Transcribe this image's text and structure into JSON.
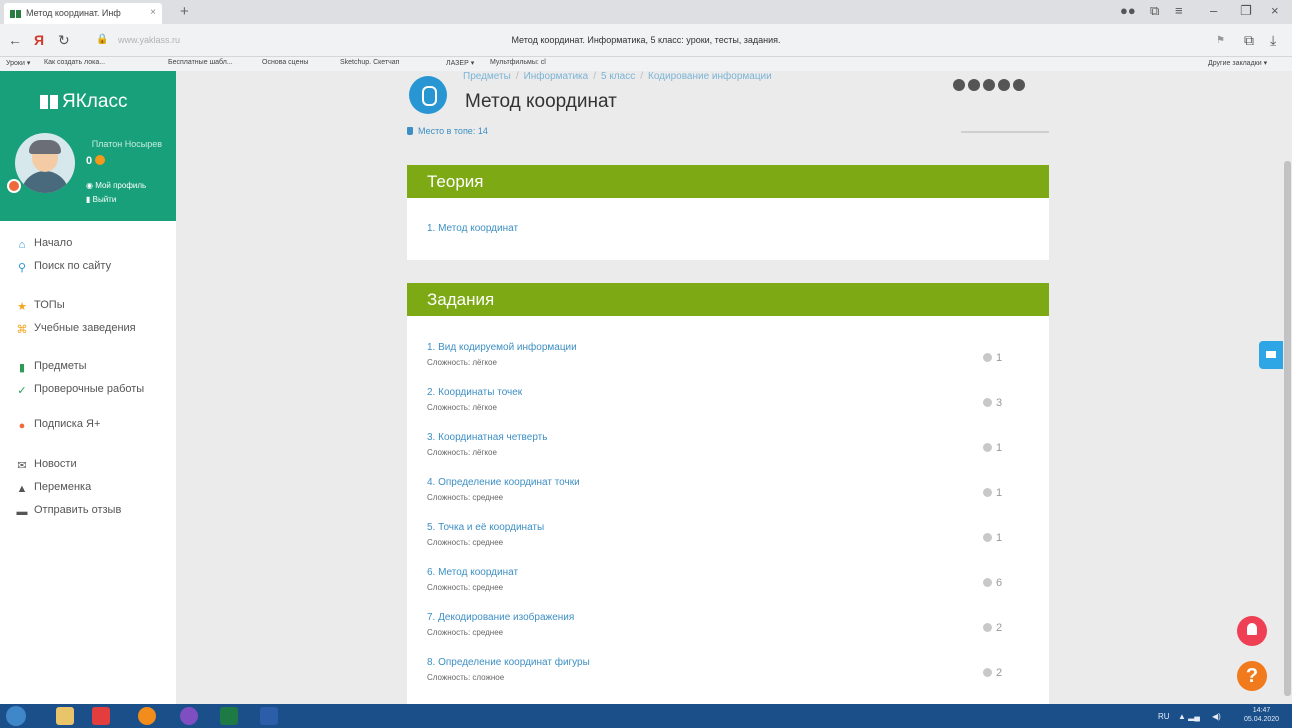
{
  "browser": {
    "tab_title": "Метод координат. Инф",
    "tab_close": "×",
    "new_tab": "+",
    "url": "www.yaklass.ru",
    "page_title": "Метод координат. Информатика, 5 класс: уроки, тесты, задания.",
    "bookmarks": [
      "Уроки ▾",
      "Как создать лока...",
      "Бесплатные шабл...",
      "Основа сцены",
      "Sketchup. Скетчап",
      "ЛАЗЕР ▾",
      "Мультфильмы: сl"
    ],
    "other_bookmarks": "Другие закладки ▾"
  },
  "sidebar": {
    "logo": "ЯКласс",
    "user_name": "Платон Носырев",
    "points": "0",
    "profile_link": "Мой профиль",
    "logout_link": "Выйти",
    "menu": [
      {
        "label": "Начало",
        "icon": "home-icon",
        "color": "#2896d2"
      },
      {
        "label": "Поиск по сайту",
        "icon": "search-icon",
        "color": "#2896d2"
      },
      {
        "label": "ТОПы",
        "icon": "star-icon",
        "color": "#f2a520"
      },
      {
        "label": "Учебные заведения",
        "icon": "school-icon",
        "color": "#f2a520"
      },
      {
        "label": "Предметы",
        "icon": "books-icon",
        "color": "#2e9a57"
      },
      {
        "label": "Проверочные работы",
        "icon": "check-icon",
        "color": "#2e9a57"
      },
      {
        "label": "Подписка Я+",
        "icon": "plus-icon",
        "color": "#ef6a3a"
      },
      {
        "label": "Новости",
        "icon": "news-icon",
        "color": "#555555"
      },
      {
        "label": "Переменка",
        "icon": "bell-icon",
        "color": "#555555"
      },
      {
        "label": "Отправить отзыв",
        "icon": "feedback-icon",
        "color": "#555555"
      }
    ]
  },
  "main": {
    "breadcrumbs": [
      "Предметы",
      "Информатика",
      "5 класс",
      "Кодирование информации"
    ],
    "crumb_sep": "/",
    "title": "Метод координат",
    "rank": "Место в топе: 14",
    "theory": {
      "heading": "Теория",
      "items": [
        "1. Метод координат"
      ]
    },
    "tasks": {
      "heading": "Задания",
      "items": [
        {
          "title": "1. Вид кодируемой информации",
          "difficulty": "Сложность: лёгкое",
          "count": "1"
        },
        {
          "title": "2. Координаты точек",
          "difficulty": "Сложность: лёгкое",
          "count": "3"
        },
        {
          "title": "3. Координатная четверть",
          "difficulty": "Сложность: лёгкое",
          "count": "1"
        },
        {
          "title": "4. Определение координат точки",
          "difficulty": "Сложность: среднее",
          "count": "1"
        },
        {
          "title": "5. Точка и её координаты",
          "difficulty": "Сложность: среднее",
          "count": "1"
        },
        {
          "title": "6. Метод координат",
          "difficulty": "Сложность: среднее",
          "count": "6"
        },
        {
          "title": "7. Декодирование изображения",
          "difficulty": "Сложность: среднее",
          "count": "2"
        },
        {
          "title": "8. Определение координат фигуры",
          "difficulty": "Сложность: сложное",
          "count": "2"
        }
      ]
    }
  },
  "taskbar": {
    "lang": "RU",
    "time": "14:47",
    "date": "05.04.2020"
  },
  "colors": {
    "brand_green": "#17a07a",
    "header_green": "#7daa14",
    "link_blue": "#3d8fc4"
  }
}
